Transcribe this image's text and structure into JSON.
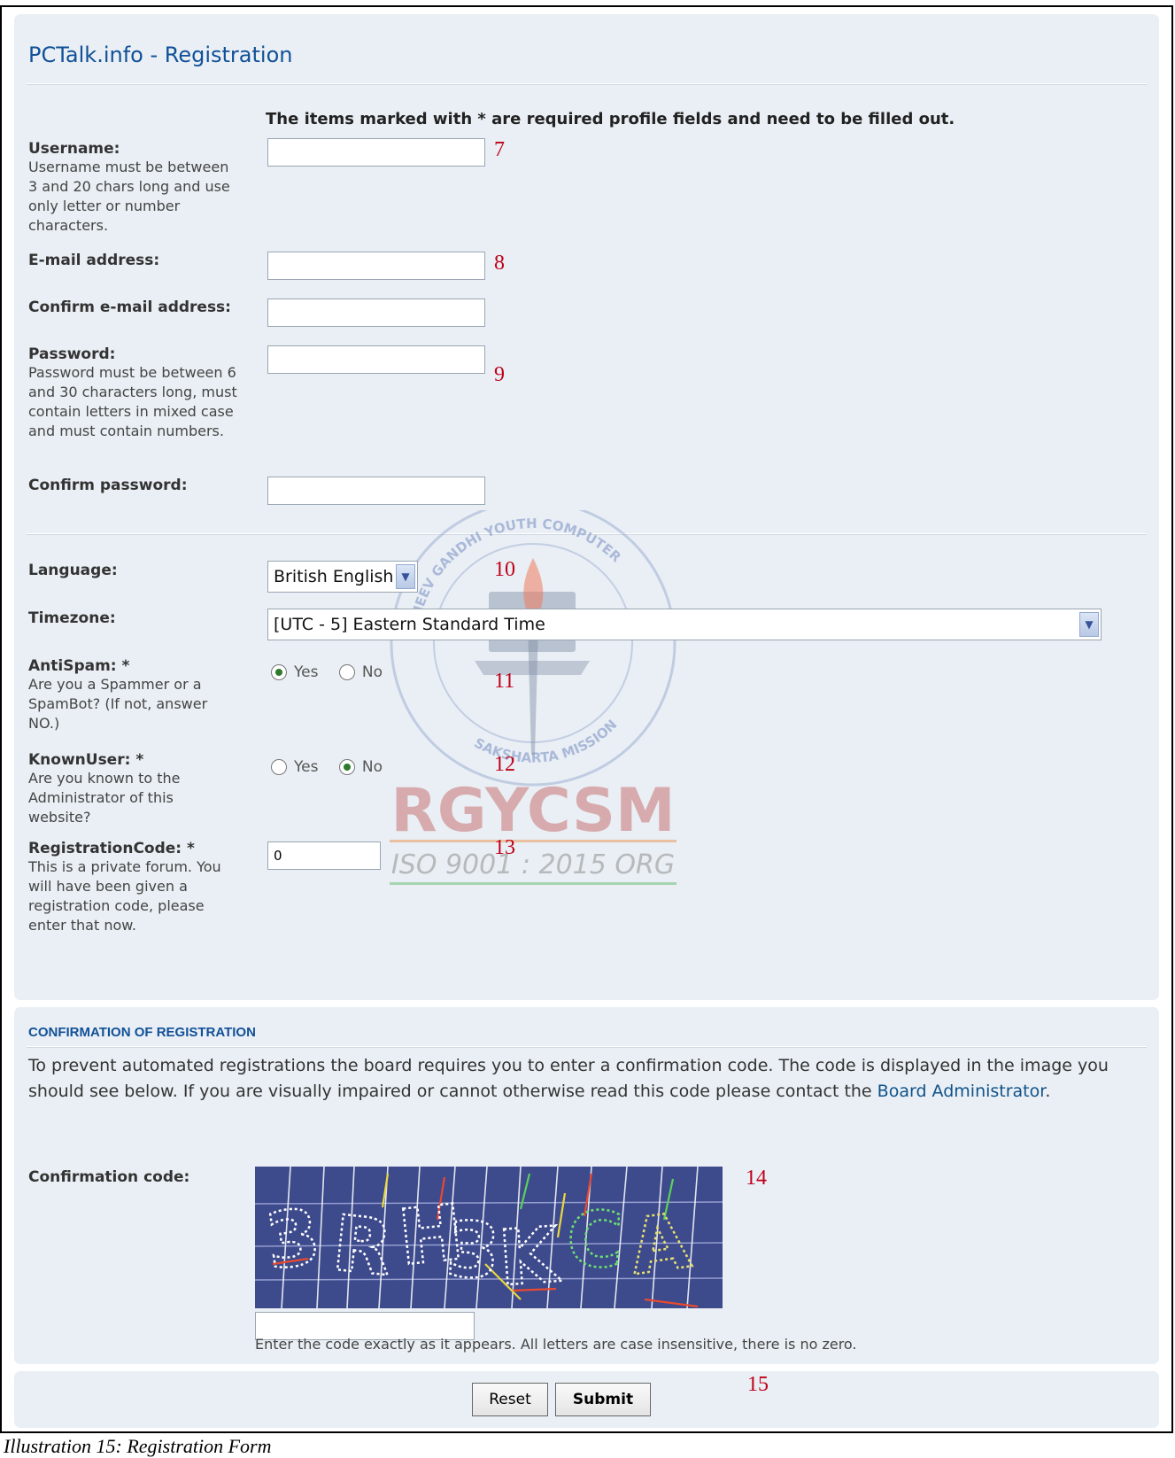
{
  "panel_title": "PCTalk.info - Registration",
  "required_note": "The items marked with * are required profile fields and need to be filled out.",
  "fields": {
    "username": {
      "label": "Username:",
      "desc": "Username must be between 3 and 20 chars long and use only letter or number characters.",
      "value": ""
    },
    "email": {
      "label": "E-mail address:",
      "value": ""
    },
    "confirm_email": {
      "label": "Confirm e-mail address:",
      "value": ""
    },
    "password": {
      "label": "Password:",
      "desc": "Password must be between 6 and 30 characters long, must contain letters in mixed case and must contain numbers.",
      "value": ""
    },
    "confirm_password": {
      "label": "Confirm password:",
      "value": ""
    },
    "language": {
      "label": "Language:",
      "value": "British English"
    },
    "timezone": {
      "label": "Timezone:",
      "value": "[UTC - 5] Eastern Standard Time"
    },
    "antispam": {
      "label": "AntiSpam: *",
      "desc": "Are you a Spammer or a SpamBot? (If not, answer NO.)",
      "options": [
        "Yes",
        "No"
      ],
      "selected": "Yes"
    },
    "knownuser": {
      "label": "KnownUser: *",
      "desc": "Are you known to the Administrator of this website?",
      "options": [
        "Yes",
        "No"
      ],
      "selected": "No"
    },
    "registration_code": {
      "label": "RegistrationCode: *",
      "desc": "This is a private forum. You will have been given a registration code, please enter that now.",
      "value": "0"
    }
  },
  "annotations": [
    "7",
    "8",
    "9",
    "10",
    "11",
    "12",
    "13",
    "14",
    "15"
  ],
  "confirmation": {
    "title": "CONFIRMATION OF REGISTRATION",
    "text_before_link": "To prevent automated registrations the board requires you to enter a confirmation code. The code is displayed in the image you should see below. If you are visually impaired or cannot otherwise read this code please contact the ",
    "link": "Board Administrator",
    "text_after_link": ".",
    "code_label": "Confirmation code:",
    "captcha_text": "3RH3KCA",
    "code_value": "",
    "hint": "Enter the code exactly as it appears. All letters are case insensitive, there is no zero."
  },
  "buttons": {
    "reset": "Reset",
    "submit": "Submit"
  },
  "watermark": {
    "ring_top": "RAJEEV GANDHI YOUTH COMPUTER",
    "ring_bottom": "SAKSHARTA MISSION",
    "brand": "RGYCSM",
    "iso": "ISO 9001 : 2015 ORG"
  },
  "caption": "Illustration 15: Registration Form",
  "colors": {
    "panel_bg": "#e9eff4",
    "title_blue": "#115098",
    "annotation_red": "#c0001a",
    "captcha_bg": "#3d4a8c"
  }
}
